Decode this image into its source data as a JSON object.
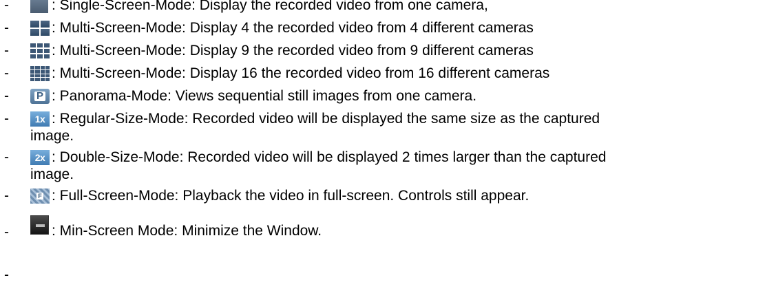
{
  "items": [
    {
      "dash": "-",
      "icon": "single-screen-icon",
      "text": ": Single-Screen-Mode: Display the recorded video from one camera,"
    },
    {
      "dash": "-",
      "icon": "multi-screen-4-icon",
      "text": ": Multi-Screen-Mode: Display 4 the recorded video from 4 different cameras"
    },
    {
      "dash": "-",
      "icon": "multi-screen-9-icon",
      "text": ": Multi-Screen-Mode: Display 9 the recorded video from 9 different cameras"
    },
    {
      "dash": "-",
      "icon": "multi-screen-16-icon",
      "text": ": Multi-Screen-Mode: Display 16 the recorded video from 16 different cameras"
    },
    {
      "dash": "-",
      "icon": "panorama-icon",
      "icon_label": "P",
      "text": ": Panorama-Mode: Views sequential still images from one camera."
    },
    {
      "dash": "-",
      "icon": "regular-size-icon",
      "icon_label": "1x",
      "text": ": Regular-Size-Mode: Recorded video will be displayed the same size as the captured",
      "text_cont": "image."
    },
    {
      "dash": "-",
      "icon": "double-size-icon",
      "icon_label": "2x",
      "text": ": Double-Size-Mode: Recorded video will be displayed 2 times larger than the captured",
      "text_cont": "image."
    },
    {
      "dash": "-",
      "icon": "full-screen-icon",
      "icon_label": "F",
      "text": ":  Full-Screen-Mode: Playback the video in full-screen.  Controls still appear."
    },
    {
      "dash": "-",
      "icon": "min-screen-icon",
      "text": ": Min-Screen Mode: Minimize the Window."
    },
    {
      "dash": "-"
    }
  ]
}
